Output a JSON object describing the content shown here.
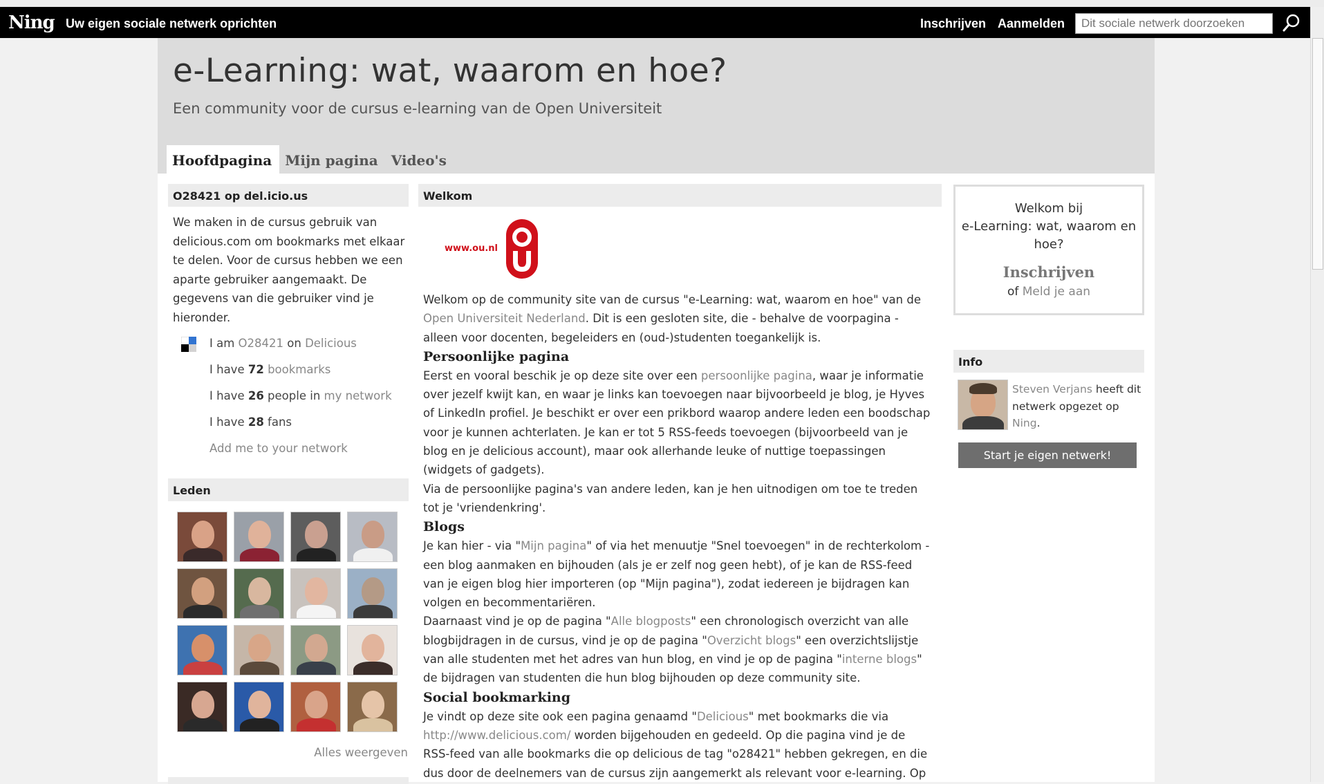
{
  "ningbar": {
    "logo": "Ning",
    "tagline": "Uw eigen sociale netwerk oprichten",
    "signup": "Inschrijven",
    "signin": "Aanmelden",
    "search_placeholder": "Dit sociale netwerk doorzoeken",
    "search_icon": "magnifier-icon"
  },
  "header": {
    "title": "e-Learning: wat, waarom en hoe?",
    "description": "Een community voor de cursus e-learning van de Open Universiteit"
  },
  "tabs": [
    "Hoofdpagina",
    "Mijn pagina",
    "Video's"
  ],
  "delicious": {
    "heading": "O28421 op del.icio.us",
    "text": "We maken in de cursus gebruik van delicious.com om bookmarks met elkaar te delen. Voor de cursus hebben we een aparte gebruiker aangemaakt. De gegevens van die gebruiker vind je hieronder.",
    "row1_pre": "I am ",
    "row1_user": "O28421",
    "row1_mid": " on ",
    "row1_link": "Delicious",
    "row2_pre": "I have ",
    "row2_num": "72",
    "row2_link": "bookmarks",
    "row3_pre": "I have ",
    "row3_num": "26",
    "row3_mid": " people in ",
    "row3_link": "my network",
    "row4_pre": "I have ",
    "row4_num": "28",
    "row4_post": " fans",
    "add_link": "Add me to your network"
  },
  "members": {
    "heading": "Leden",
    "view_all": "Alles weergeven",
    "avatars": [
      {
        "bg": "#7a4a3a",
        "face": "#d9a287",
        "body": "#3a2a2a"
      },
      {
        "bg": "#9aa0a8",
        "face": "#e0b29a",
        "body": "#8b2233"
      },
      {
        "bg": "#5d5d5d",
        "face": "#c9a090",
        "body": "#222222"
      },
      {
        "bg": "#b8bcc4",
        "face": "#c99c86",
        "body": "#f0f0f0"
      },
      {
        "bg": "#6f5440",
        "face": "#d2a07f",
        "body": "#2b2b2b"
      },
      {
        "bg": "#556b4e",
        "face": "#d8b79f",
        "body": "#6f6f6f"
      },
      {
        "bg": "#c8c2bd",
        "face": "#e2b6a0",
        "body": "#f4f4f4"
      },
      {
        "bg": "#9bb0c6",
        "face": "#b49a86",
        "body": "#3b3b3b"
      },
      {
        "bg": "#3e72b0",
        "face": "#d7906a",
        "body": "#c94040"
      },
      {
        "bg": "#c5b6a8",
        "face": "#d8a688",
        "body": "#5b4a3b"
      },
      {
        "bg": "#8c9a84",
        "face": "#d2a890",
        "body": "#39404a"
      },
      {
        "bg": "#e8e2dd",
        "face": "#e2b49c",
        "body": "#3b2d2a"
      },
      {
        "bg": "#3a2a25",
        "face": "#d7a791",
        "body": "#2a2a2a"
      },
      {
        "bg": "#2a5aa8",
        "face": "#e0b49c",
        "body": "#222222"
      },
      {
        "bg": "#b06040",
        "face": "#d9a48a",
        "body": "#c43030"
      },
      {
        "bg": "#8a6a4a",
        "face": "#e5c4a8",
        "body": "#d9c2a0"
      }
    ]
  },
  "welkom": {
    "heading": "Welkom",
    "logo_text": "www.ou.nl",
    "p1_a": "Welkom op de community site van de cursus \"e-Learning: wat, waarom en hoe\" van de ",
    "p1_link": "Open Universiteit Nederland",
    "p1_b": ". Dit is een gesloten site, die - behalve de voorpagina - alleen voor docenten, begeleiders en (oud-)studenten toegankelijk is.",
    "h_personal": "Persoonlijke pagina",
    "p2_a": "Eerst en vooral beschik je op deze site over een ",
    "p2_link": "persoonlijke pagina",
    "p2_b": ", waar je informatie over jezelf kwijt kan, en waar je links kan toevoegen naar bijvoorbeeld je blog, je Hyves of LinkedIn profiel. Je beschikt er over een prikbord waarop andere leden een boodschap voor je kunnen achterlaten. Je kan er tot 5 RSS-feeds toevoegen (bijvoorbeeld van je blog en je delicious account), maar ook allerhande leuke of nuttige toepassingen (widgets of gadgets).",
    "p3": "Via de persoonlijke pagina's van andere leden, kan je hen uitnodigen om toe te treden tot je 'vriendenkring'.",
    "h_blogs": "Blogs",
    "p4_a": "Je kan hier - via \"",
    "p4_link": "Mijn pagina",
    "p4_b": "\" of via het menuutje \"Snel toevoegen\" in de rechterkolom - een blog aanmaken en bijhouden (als je er zelf nog geen hebt), of je kan de RSS-feed van je eigen blog hier importeren (op \"Mijn pagina\"), zodat iedereen je bijdragen kan volgen en becommentariëren.",
    "p5_a": "Daarnaast vind je op de pagina \"",
    "p5_link1": "Alle blogposts",
    "p5_b": "\" een chronologisch overzicht van alle blogbijdragen in de cursus, vind je op de pagina \"",
    "p5_link2": "Overzicht blogs",
    "p5_c": "\" een overzichtslijstje van alle studenten met het adres van hun blog, en vind je op de pagina \"",
    "p5_link3": "interne blogs",
    "p5_d": "\" de bijdragen van studenten die hun blog bijhouden op deze community site.",
    "h_social": "Social bookmarking",
    "p6_a": "Je vindt op deze site ook een pagina genaamd \"",
    "p6_link1": "Delicious",
    "p6_b": "\" met bookmarks die via ",
    "p6_link2": "http://www.delicious.com/",
    "p6_c": " worden bijgehouden en gedeeld. Op die pagina vind je de RSS-feed van alle bookmarks die op delicious de tag \"o28421\" hebben gekregen, en die dus door de deelnemers van de cursus zijn aangemerkt als relevant voor e-learning. Op"
  },
  "welcome_box": {
    "line1": "Welkom bij",
    "line2": "e-Learning: wat, waarom en hoe?",
    "signup": "Inschrijven",
    "or": "of ",
    "signin": "Meld je aan"
  },
  "info": {
    "heading": "Info",
    "creator": "Steven Verjans",
    "text_a": " heeft dit netwerk opgezet op ",
    "ning_link": "Ning",
    "text_b": ".",
    "start_button": "Start je eigen netwerk!"
  }
}
